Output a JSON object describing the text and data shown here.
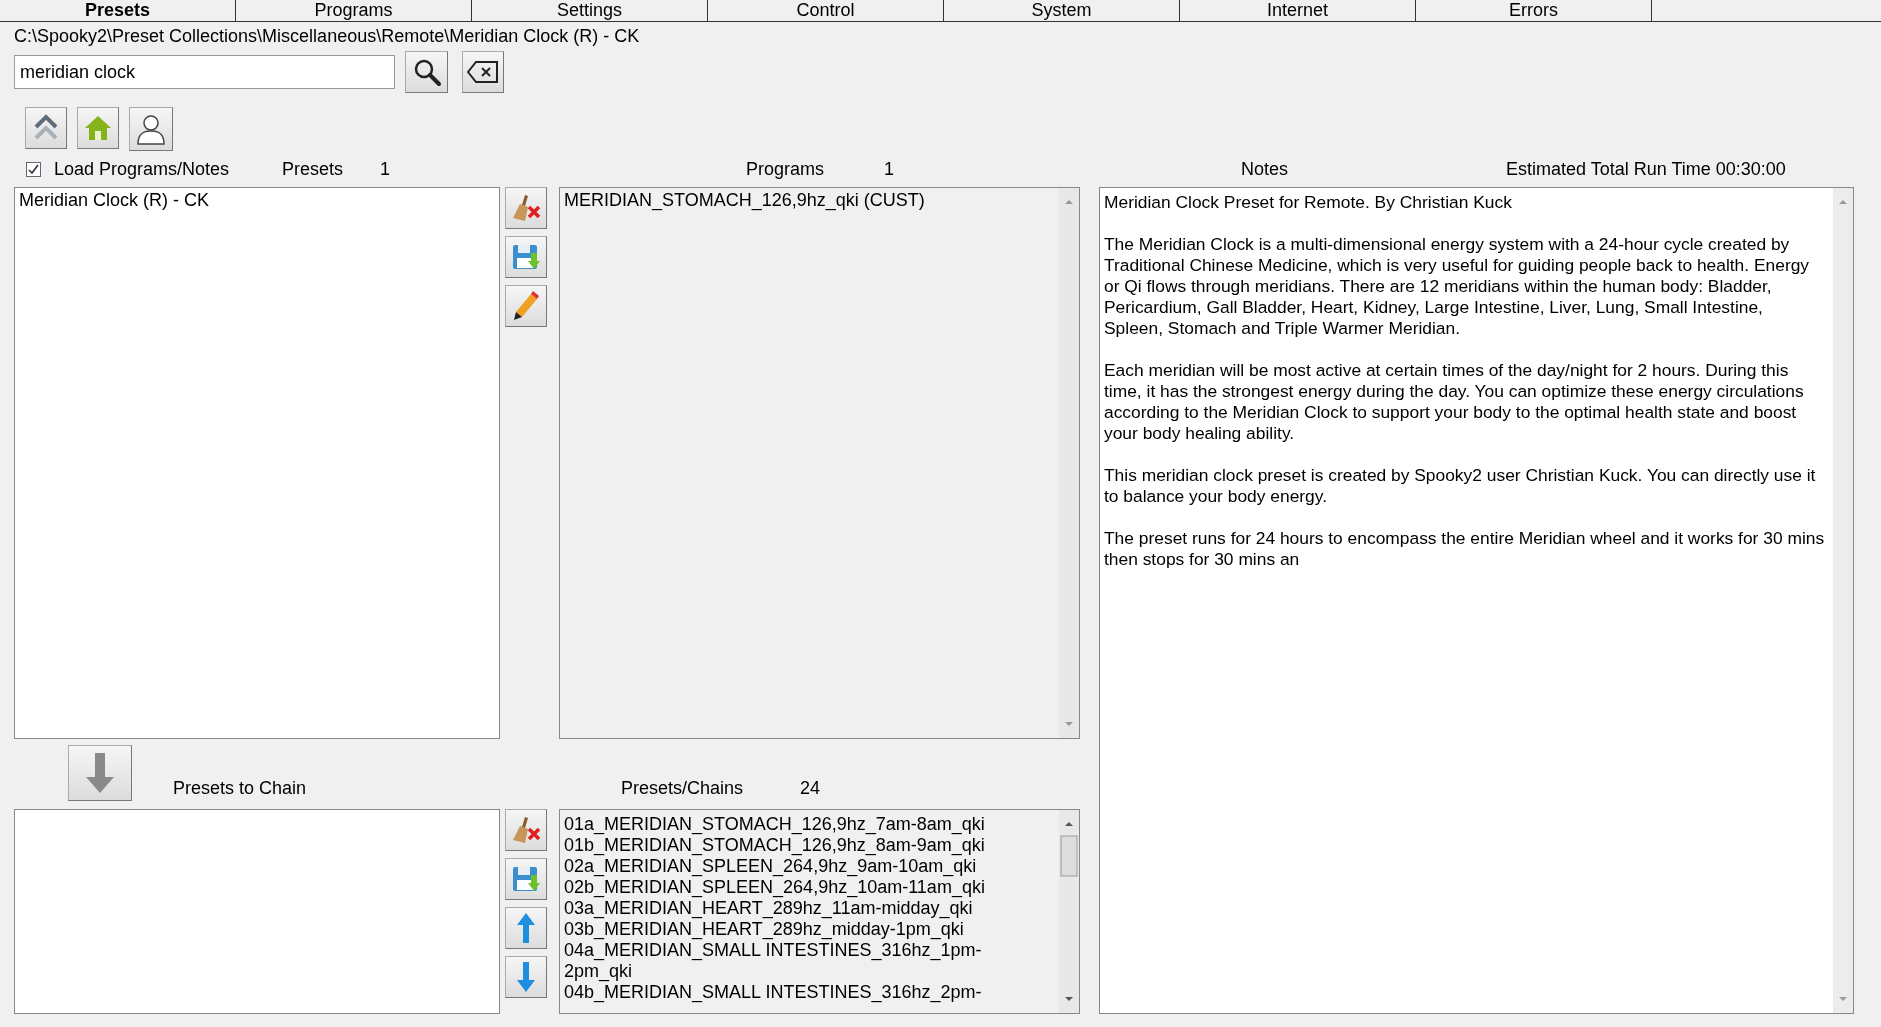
{
  "tabs": [
    {
      "label": "Presets",
      "selected": true
    },
    {
      "label": "Programs",
      "selected": false
    },
    {
      "label": "Settings",
      "selected": false
    },
    {
      "label": "Control",
      "selected": false
    },
    {
      "label": "System",
      "selected": false
    },
    {
      "label": "Internet",
      "selected": false
    },
    {
      "label": "Errors",
      "selected": false
    }
  ],
  "path": "C:\\Spooky2\\Preset Collections\\Miscellaneous\\Remote\\Meridian Clock (R) - CK",
  "search": {
    "value": "meridian clock"
  },
  "load_programs_notes": {
    "label": "Load Programs/Notes",
    "checked": true
  },
  "presets": {
    "label": "Presets",
    "count": "1",
    "items": [
      "Meridian Clock (R) - CK"
    ]
  },
  "programs": {
    "label": "Programs",
    "count": "1",
    "items": [
      "MERIDIAN_STOMACH_126,9hz_qki (CUST)"
    ]
  },
  "notes": {
    "label": "Notes",
    "run_time": "Estimated Total Run Time 00:30:00",
    "paragraphs": [
      "Meridian Clock Preset for Remote. By Christian Kuck",
      "The Meridian Clock is a multi-dimensional energy system with a 24-hour cycle created by Traditional Chinese Medicine, which is very useful for guiding people back to health. Energy or Qi flows through meridians. There are 12 meridians within the human body: Bladder, Pericardium, Gall Bladder, Heart, Kidney, Large Intestine, Liver, Lung, Small Intestine, Spleen, Stomach and Triple Warmer Meridian.",
      "Each meridian will be most active at certain times of the day/night for 2 hours. During this time, it has the strongest energy during the day. You can optimize these energy circulations according to the Meridian Clock to support your body to the optimal health state and boost your body healing ability.",
      "This meridian clock preset is created by Spooky2 user Christian Kuck. You can directly use it to balance your body energy.",
      "The preset runs for 24 hours to encompass the entire Meridian wheel and it works for 30 mins then stops for 30 mins an"
    ]
  },
  "presets_to_chain": {
    "label": "Presets to Chain"
  },
  "presets_chains": {
    "label": "Presets/Chains",
    "count": "24",
    "items": [
      "01a_MERIDIAN_STOMACH_126,9hz_7am-8am_qki",
      "01b_MERIDIAN_STOMACH_126,9hz_8am-9am_qki",
      "02a_MERIDIAN_SPLEEN_264,9hz_9am-10am_qki",
      "02b_MERIDIAN_SPLEEN_264,9hz_10am-11am_qki",
      "03a_MERIDIAN_HEART_289hz_11am-midday_qki",
      "03b_MERIDIAN_HEART_289hz_midday-1pm_qki",
      "04a_MERIDIAN_SMALL INTESTINES_316hz_1pm-2pm_qki",
      "04b_MERIDIAN_SMALL INTESTINES_316hz_2pm-"
    ]
  }
}
